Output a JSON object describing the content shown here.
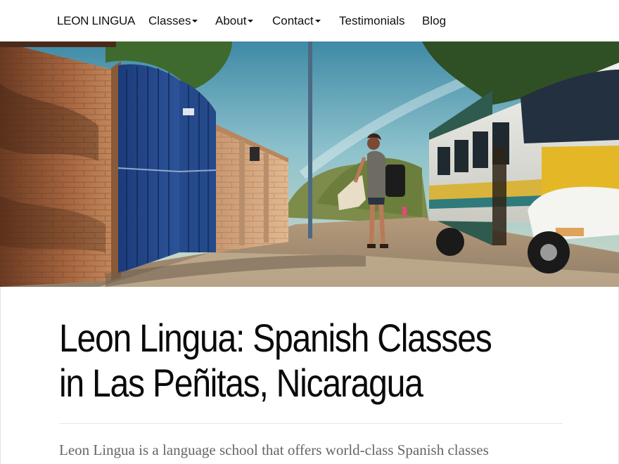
{
  "nav": {
    "brand": "LEON LINGUA",
    "items": [
      {
        "label": "Classes",
        "dropdown": true
      },
      {
        "label": "About",
        "dropdown": true
      },
      {
        "label": "Contact",
        "dropdown": true
      },
      {
        "label": "Testimonials",
        "dropdown": false
      },
      {
        "label": "Blog",
        "dropdown": false
      }
    ]
  },
  "hero": {
    "alt": "Woman walking on a sunny street between a blue gate and a painted school bus"
  },
  "page": {
    "title": "Leon Lingua: Spanish Classes in Las Peñitas, Nicaragua",
    "intro": "Leon Lingua is a language school that offers world-class Spanish classes"
  }
}
